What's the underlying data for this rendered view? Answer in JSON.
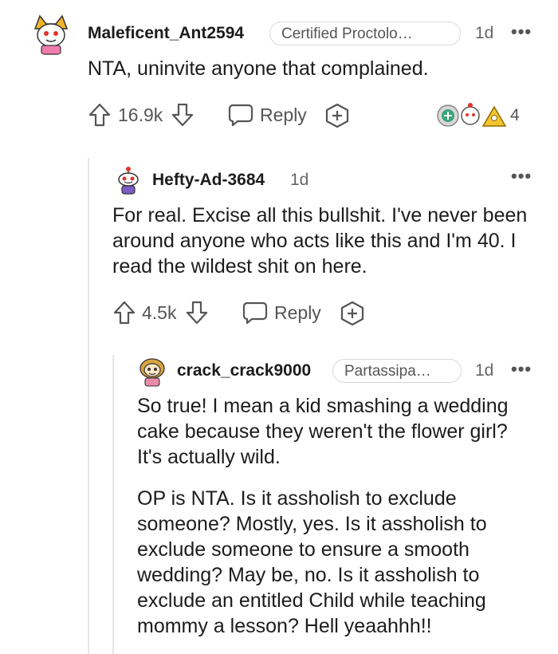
{
  "comments": [
    {
      "username": "Maleficent_Ant2594",
      "flair": "Certified Proctolo…",
      "time": "1d",
      "more": "•••",
      "body": [
        "NTA, uninvite anyone that complained."
      ],
      "votes": "16.9k",
      "reply": "Reply",
      "award_count": "4"
    },
    {
      "username": "Hefty-Ad-3684",
      "time": "1d",
      "more": "•••",
      "body": [
        "For real. Excise all this bullshit. I've never been around anyone who acts like this and I'm 40. I read the wildest shit on here."
      ],
      "votes": "4.5k",
      "reply": "Reply"
    },
    {
      "username": "crack_crack9000",
      "flair": "Partassipa…",
      "time": "1d",
      "more": "•••",
      "body": [
        "So true! I mean a kid smashing a wedding cake because they weren't the flower girl? It's actually wild.",
        "OP is NTA. Is it assholish to exclude someone? Mostly, yes. Is it assholish to exclude someone to ensure a smooth wedding? May be, no. Is it assholish to exclude an entitled Child while teaching mommy a lesson? Hell yeaahhh!!"
      ]
    }
  ],
  "icons": {
    "upvote": "upvote-arrow-icon",
    "downvote": "downvote-arrow-icon",
    "reply": "speech-bubble-icon",
    "award": "award-plus-icon",
    "more": "more-options-icon"
  },
  "colors": {
    "text": "#1c1c1c",
    "muted": "#555555",
    "thread": "#e3e6e8",
    "flair_border": "#d6d9db"
  }
}
